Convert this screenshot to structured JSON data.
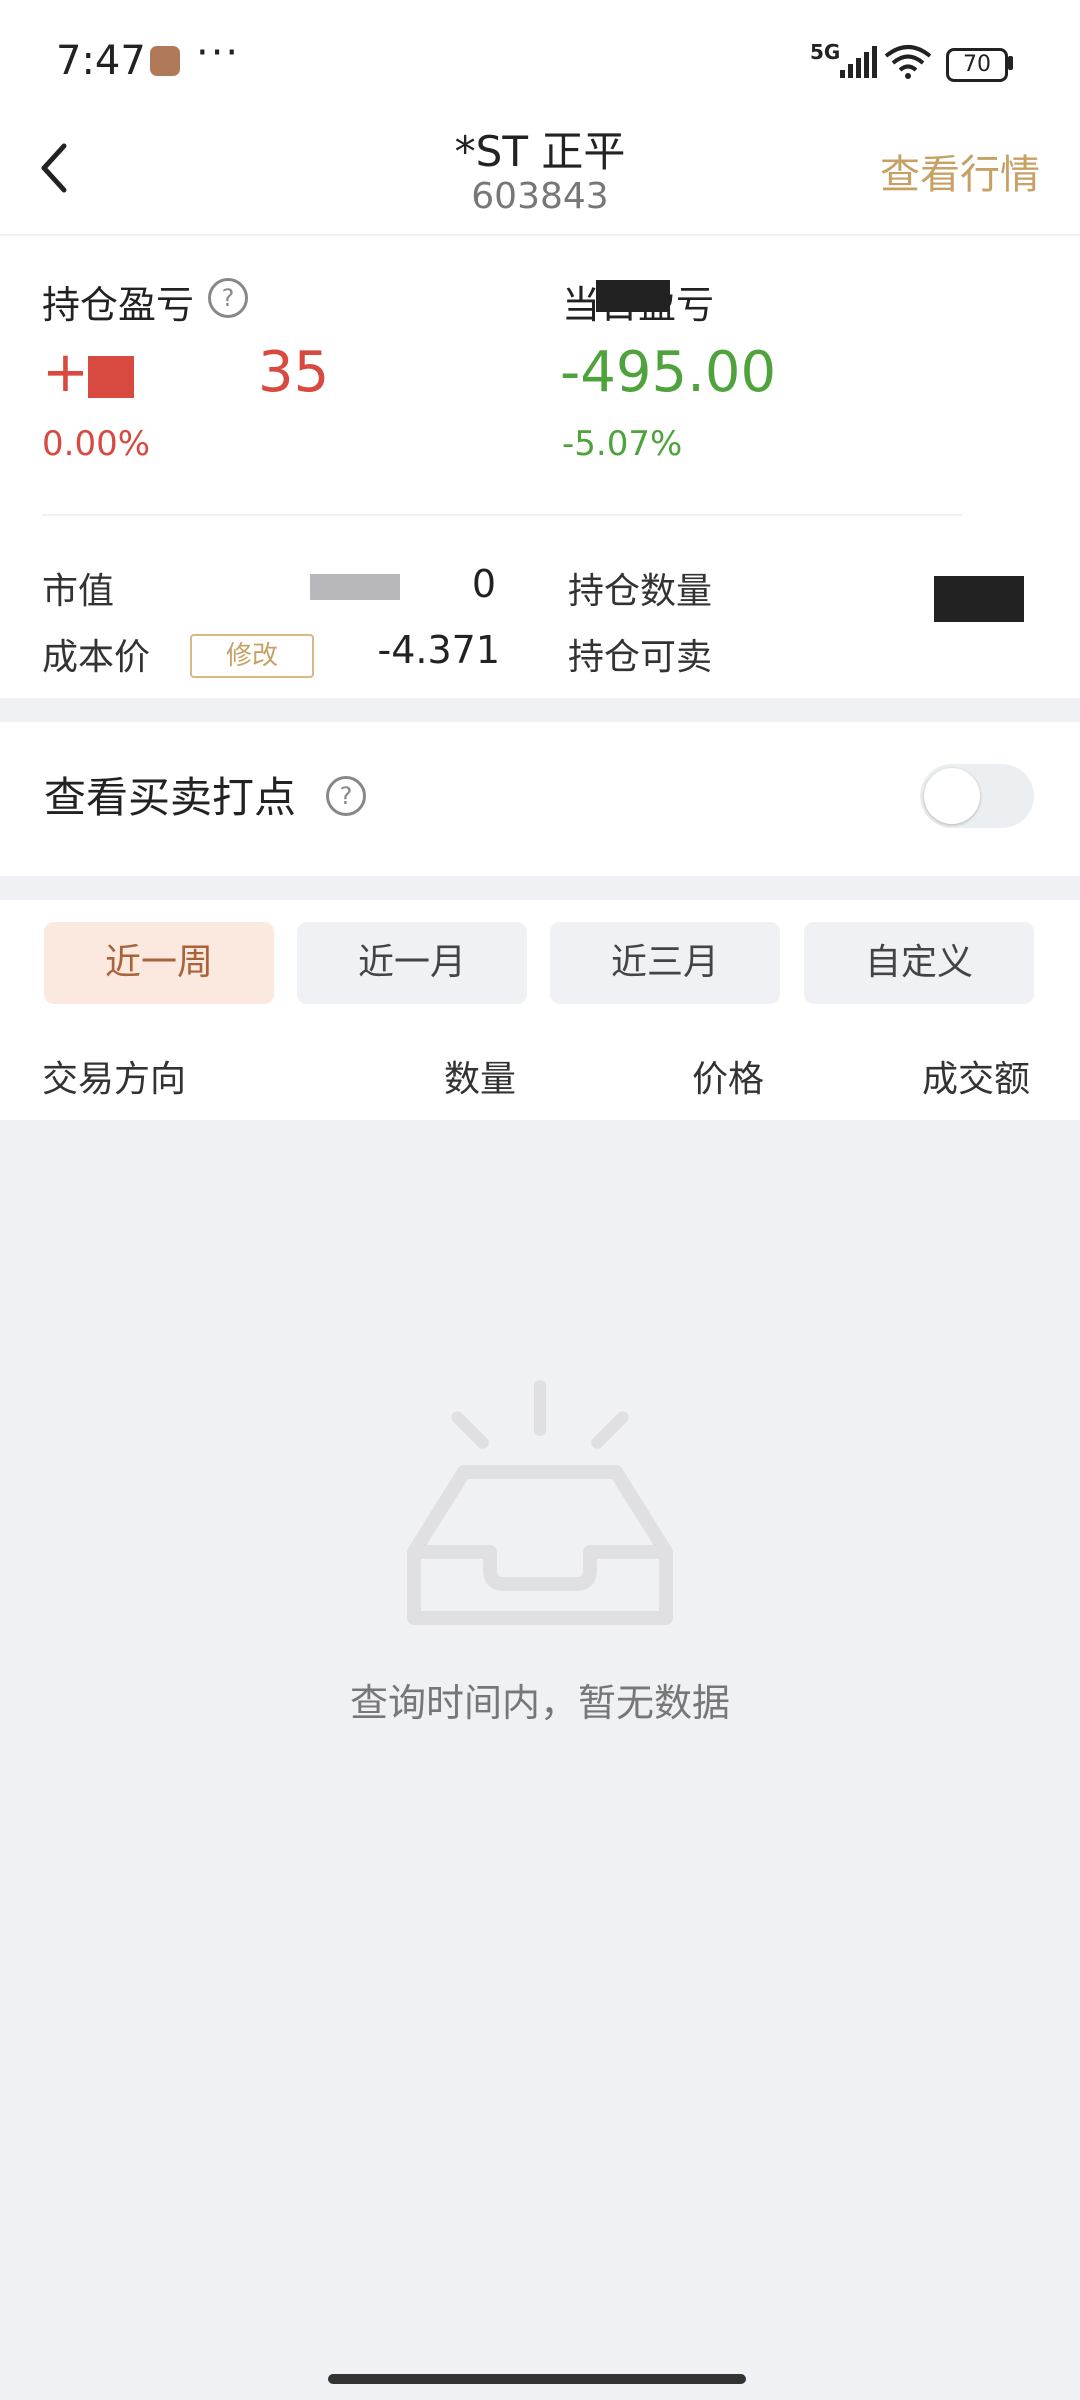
{
  "status_bar": {
    "time": "7:47",
    "network": "5G",
    "battery": "70"
  },
  "header": {
    "title": "*ST 正平",
    "code": "603843",
    "quote_link": "查看行情"
  },
  "summary": {
    "position_pl": {
      "label": "持仓盈亏",
      "value_visible": "35",
      "pct": "0.00%"
    },
    "today_pl": {
      "label": "当日盈亏",
      "value_visible": "-495.00",
      "pct": "-5.07%"
    },
    "market_value": {
      "label": "市值",
      "value_visible": "0"
    },
    "cost_price": {
      "label": "成本价",
      "edit_label": "修改",
      "value": "-4.371"
    },
    "holding_qty": {
      "label": "持仓数量"
    },
    "holding_sellable": {
      "label": "持仓可卖"
    }
  },
  "toggle": {
    "label": "查看买卖打点",
    "state": "off"
  },
  "tabs": [
    {
      "label": "近一周",
      "active": true
    },
    {
      "label": "近一月",
      "active": false
    },
    {
      "label": "近三月",
      "active": false
    },
    {
      "label": "自定义",
      "active": false
    }
  ],
  "columns": [
    "交易方向",
    "数量",
    "价格",
    "成交额"
  ],
  "empty_state": {
    "message": "查询时间内，暂无数据"
  },
  "colors": {
    "red": "#d84a3f",
    "green": "#4fa33c",
    "accent": "#c7a164",
    "active_tab_bg": "#fbe9df"
  }
}
